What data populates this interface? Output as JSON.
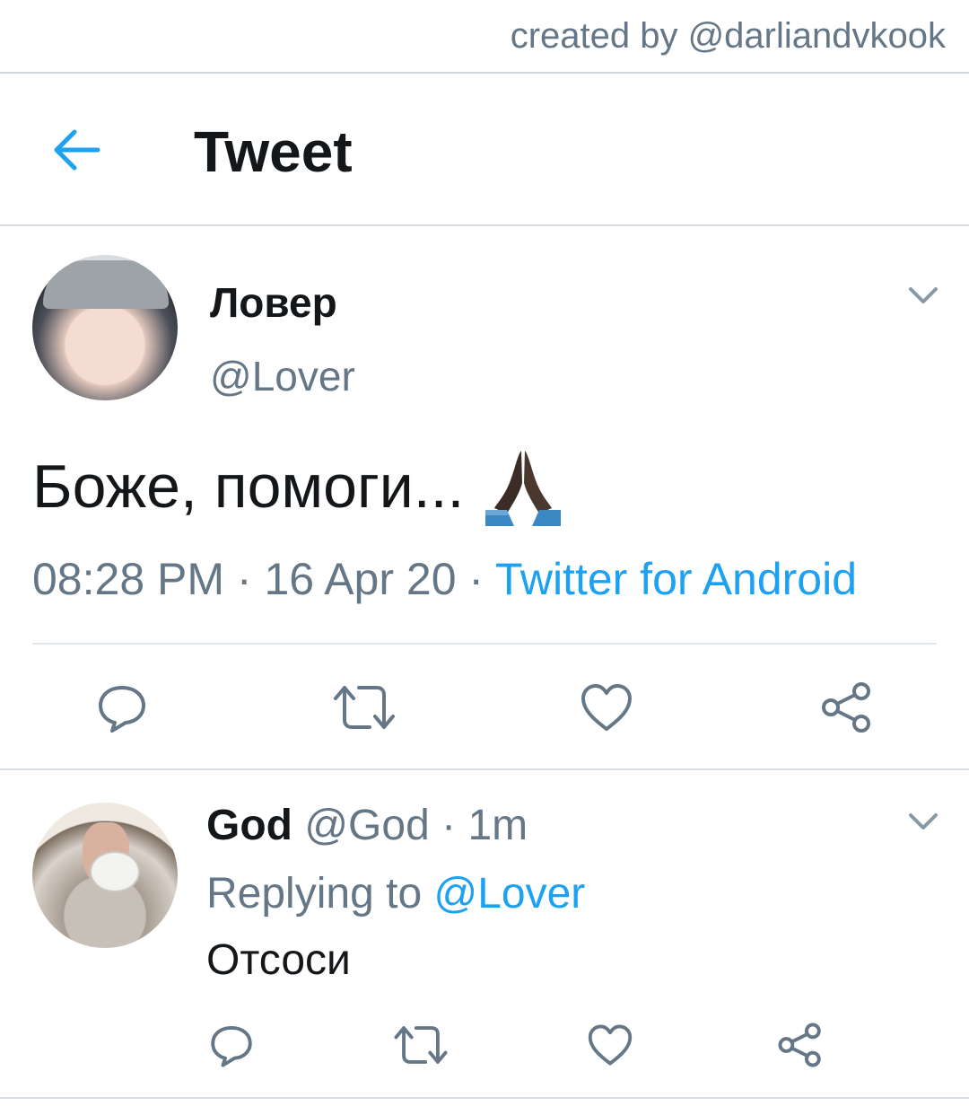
{
  "credit": "created by @darliandvkook",
  "header": {
    "title": "Tweet",
    "back_icon": "arrow-left-icon"
  },
  "tweet": {
    "display_name": "Ловер",
    "handle": "@Lover",
    "text": "Боже, помоги...",
    "emoji": "folded-hands-icon",
    "time": "08:28 PM",
    "sep": " · ",
    "date": "16 Apr 20",
    "source": "Twitter for Android",
    "actions": [
      "reply-icon",
      "retweet-icon",
      "like-icon",
      "share-icon"
    ]
  },
  "reply": {
    "display_name": "God",
    "handle": "@God",
    "age": "1m",
    "sep": " · ",
    "replying_prefix": "Replying to",
    "replying_to": "@Lover",
    "text": "Отсоси",
    "actions": [
      "reply-icon",
      "retweet-icon",
      "like-icon",
      "share-icon"
    ]
  },
  "colors": {
    "accent": "#1da1f2",
    "secondary_text": "#657786",
    "primary_text": "#14171a",
    "icon": "#657786"
  }
}
